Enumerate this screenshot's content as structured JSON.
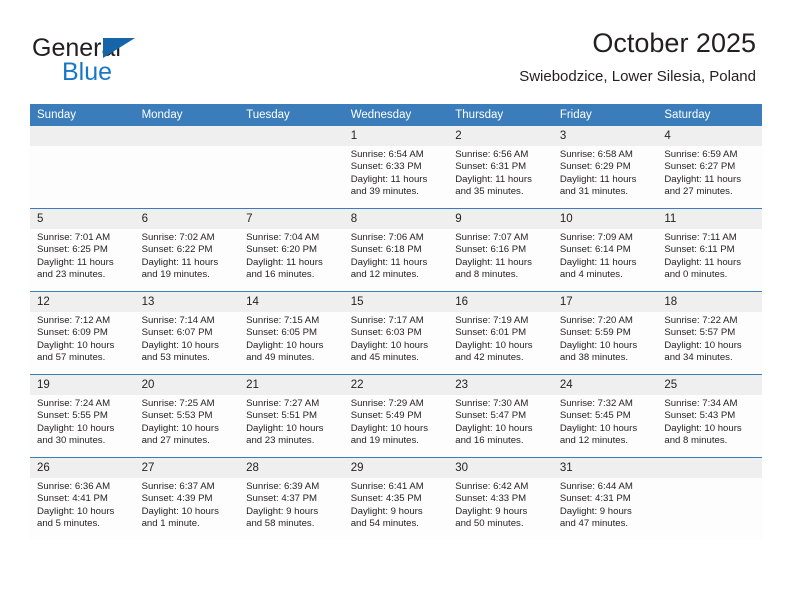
{
  "brand": {
    "name_part1": "General",
    "name_part2": "Blue",
    "flag_icon": "triangle-flag-icon"
  },
  "header": {
    "title": "October 2025",
    "subtitle": "Swiebodzice, Lower Silesia, Poland"
  },
  "colors": {
    "header_blue": "#3a7dba",
    "brand_blue": "#1878c8",
    "daynum_band": "#efefef",
    "text": "#231f20"
  },
  "weekday_headers": [
    "Sunday",
    "Monday",
    "Tuesday",
    "Wednesday",
    "Thursday",
    "Friday",
    "Saturday"
  ],
  "weeks": [
    [
      {
        "day": "",
        "empty": true
      },
      {
        "day": "",
        "empty": true
      },
      {
        "day": "",
        "empty": true
      },
      {
        "day": "1",
        "sunrise": "Sunrise: 6:54 AM",
        "sunset": "Sunset: 6:33 PM",
        "daylight1": "Daylight: 11 hours",
        "daylight2": "and 39 minutes."
      },
      {
        "day": "2",
        "sunrise": "Sunrise: 6:56 AM",
        "sunset": "Sunset: 6:31 PM",
        "daylight1": "Daylight: 11 hours",
        "daylight2": "and 35 minutes."
      },
      {
        "day": "3",
        "sunrise": "Sunrise: 6:58 AM",
        "sunset": "Sunset: 6:29 PM",
        "daylight1": "Daylight: 11 hours",
        "daylight2": "and 31 minutes."
      },
      {
        "day": "4",
        "sunrise": "Sunrise: 6:59 AM",
        "sunset": "Sunset: 6:27 PM",
        "daylight1": "Daylight: 11 hours",
        "daylight2": "and 27 minutes."
      }
    ],
    [
      {
        "day": "5",
        "sunrise": "Sunrise: 7:01 AM",
        "sunset": "Sunset: 6:25 PM",
        "daylight1": "Daylight: 11 hours",
        "daylight2": "and 23 minutes."
      },
      {
        "day": "6",
        "sunrise": "Sunrise: 7:02 AM",
        "sunset": "Sunset: 6:22 PM",
        "daylight1": "Daylight: 11 hours",
        "daylight2": "and 19 minutes."
      },
      {
        "day": "7",
        "sunrise": "Sunrise: 7:04 AM",
        "sunset": "Sunset: 6:20 PM",
        "daylight1": "Daylight: 11 hours",
        "daylight2": "and 16 minutes."
      },
      {
        "day": "8",
        "sunrise": "Sunrise: 7:06 AM",
        "sunset": "Sunset: 6:18 PM",
        "daylight1": "Daylight: 11 hours",
        "daylight2": "and 12 minutes."
      },
      {
        "day": "9",
        "sunrise": "Sunrise: 7:07 AM",
        "sunset": "Sunset: 6:16 PM",
        "daylight1": "Daylight: 11 hours",
        "daylight2": "and 8 minutes."
      },
      {
        "day": "10",
        "sunrise": "Sunrise: 7:09 AM",
        "sunset": "Sunset: 6:14 PM",
        "daylight1": "Daylight: 11 hours",
        "daylight2": "and 4 minutes."
      },
      {
        "day": "11",
        "sunrise": "Sunrise: 7:11 AM",
        "sunset": "Sunset: 6:11 PM",
        "daylight1": "Daylight: 11 hours",
        "daylight2": "and 0 minutes."
      }
    ],
    [
      {
        "day": "12",
        "sunrise": "Sunrise: 7:12 AM",
        "sunset": "Sunset: 6:09 PM",
        "daylight1": "Daylight: 10 hours",
        "daylight2": "and 57 minutes."
      },
      {
        "day": "13",
        "sunrise": "Sunrise: 7:14 AM",
        "sunset": "Sunset: 6:07 PM",
        "daylight1": "Daylight: 10 hours",
        "daylight2": "and 53 minutes."
      },
      {
        "day": "14",
        "sunrise": "Sunrise: 7:15 AM",
        "sunset": "Sunset: 6:05 PM",
        "daylight1": "Daylight: 10 hours",
        "daylight2": "and 49 minutes."
      },
      {
        "day": "15",
        "sunrise": "Sunrise: 7:17 AM",
        "sunset": "Sunset: 6:03 PM",
        "daylight1": "Daylight: 10 hours",
        "daylight2": "and 45 minutes."
      },
      {
        "day": "16",
        "sunrise": "Sunrise: 7:19 AM",
        "sunset": "Sunset: 6:01 PM",
        "daylight1": "Daylight: 10 hours",
        "daylight2": "and 42 minutes."
      },
      {
        "day": "17",
        "sunrise": "Sunrise: 7:20 AM",
        "sunset": "Sunset: 5:59 PM",
        "daylight1": "Daylight: 10 hours",
        "daylight2": "and 38 minutes."
      },
      {
        "day": "18",
        "sunrise": "Sunrise: 7:22 AM",
        "sunset": "Sunset: 5:57 PM",
        "daylight1": "Daylight: 10 hours",
        "daylight2": "and 34 minutes."
      }
    ],
    [
      {
        "day": "19",
        "sunrise": "Sunrise: 7:24 AM",
        "sunset": "Sunset: 5:55 PM",
        "daylight1": "Daylight: 10 hours",
        "daylight2": "and 30 minutes."
      },
      {
        "day": "20",
        "sunrise": "Sunrise: 7:25 AM",
        "sunset": "Sunset: 5:53 PM",
        "daylight1": "Daylight: 10 hours",
        "daylight2": "and 27 minutes."
      },
      {
        "day": "21",
        "sunrise": "Sunrise: 7:27 AM",
        "sunset": "Sunset: 5:51 PM",
        "daylight1": "Daylight: 10 hours",
        "daylight2": "and 23 minutes."
      },
      {
        "day": "22",
        "sunrise": "Sunrise: 7:29 AM",
        "sunset": "Sunset: 5:49 PM",
        "daylight1": "Daylight: 10 hours",
        "daylight2": "and 19 minutes."
      },
      {
        "day": "23",
        "sunrise": "Sunrise: 7:30 AM",
        "sunset": "Sunset: 5:47 PM",
        "daylight1": "Daylight: 10 hours",
        "daylight2": "and 16 minutes."
      },
      {
        "day": "24",
        "sunrise": "Sunrise: 7:32 AM",
        "sunset": "Sunset: 5:45 PM",
        "daylight1": "Daylight: 10 hours",
        "daylight2": "and 12 minutes."
      },
      {
        "day": "25",
        "sunrise": "Sunrise: 7:34 AM",
        "sunset": "Sunset: 5:43 PM",
        "daylight1": "Daylight: 10 hours",
        "daylight2": "and 8 minutes."
      }
    ],
    [
      {
        "day": "26",
        "sunrise": "Sunrise: 6:36 AM",
        "sunset": "Sunset: 4:41 PM",
        "daylight1": "Daylight: 10 hours",
        "daylight2": "and 5 minutes."
      },
      {
        "day": "27",
        "sunrise": "Sunrise: 6:37 AM",
        "sunset": "Sunset: 4:39 PM",
        "daylight1": "Daylight: 10 hours",
        "daylight2": "and 1 minute."
      },
      {
        "day": "28",
        "sunrise": "Sunrise: 6:39 AM",
        "sunset": "Sunset: 4:37 PM",
        "daylight1": "Daylight: 9 hours",
        "daylight2": "and 58 minutes."
      },
      {
        "day": "29",
        "sunrise": "Sunrise: 6:41 AM",
        "sunset": "Sunset: 4:35 PM",
        "daylight1": "Daylight: 9 hours",
        "daylight2": "and 54 minutes."
      },
      {
        "day": "30",
        "sunrise": "Sunrise: 6:42 AM",
        "sunset": "Sunset: 4:33 PM",
        "daylight1": "Daylight: 9 hours",
        "daylight2": "and 50 minutes."
      },
      {
        "day": "31",
        "sunrise": "Sunrise: 6:44 AM",
        "sunset": "Sunset: 4:31 PM",
        "daylight1": "Daylight: 9 hours",
        "daylight2": "and 47 minutes."
      },
      {
        "day": "",
        "empty": true
      }
    ]
  ]
}
